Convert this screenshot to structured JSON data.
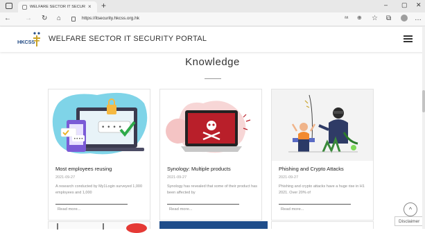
{
  "browser": {
    "tab_title": "WELFARE SECTOR IT SECURITY P",
    "tab_close": "×",
    "new_tab": "+",
    "url": "https://itsecurity.hkcss.org.hk",
    "win_min": "‒",
    "win_max": "▢",
    "win_close": "✕"
  },
  "header": {
    "logo_text": "HKCSS",
    "title": "WELFARE SECTOR IT SECURITY PORTAL"
  },
  "section": {
    "title": "Knowledge"
  },
  "cards": [
    {
      "title": "Most employees reusing",
      "date": "2021-09-27",
      "desc": "A research conducted by My1Login surveyed 1,000 employees and 1,000",
      "more": "Read more..."
    },
    {
      "title": "Synology: Multiple products",
      "date": "2021-09-27",
      "desc": "Synology has revealed that some of their product has been affected by",
      "more": "Read more..."
    },
    {
      "title": "Phishing and Crypto Attacks",
      "date": "2021-09-27",
      "desc": "Phishing and crypto attacks have a huge rise in H1 2021. Over 20% of",
      "more": "Read more..."
    }
  ],
  "scroll_top": "^",
  "disclaimer": "Disclaimer",
  "colors": {
    "brand": "#244c85",
    "logo_gold": "#c9a227",
    "heading": "#333333",
    "muted": "#888888"
  }
}
